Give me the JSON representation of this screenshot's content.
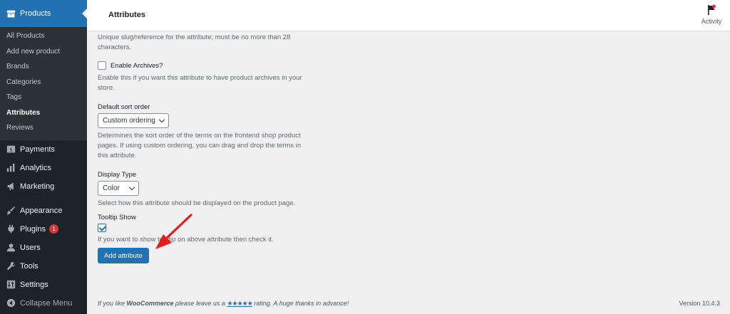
{
  "sidebar": {
    "products_label": "Products",
    "submenu": [
      "All Products",
      "Add new product",
      "Brands",
      "Categories",
      "Tags",
      "Attributes",
      "Reviews"
    ],
    "current_submenu": "Attributes",
    "payments": "Payments",
    "analytics": "Analytics",
    "marketing": "Marketing",
    "appearance": "Appearance",
    "plugins": "Plugins",
    "plugins_badge": "1",
    "users": "Users",
    "tools": "Tools",
    "settings": "Settings",
    "collapse": "Collapse Menu"
  },
  "header": {
    "title": "Attributes",
    "activity_label": "Activity"
  },
  "form": {
    "slug_desc": "Unique slug/reference for the attribute; must be no more than 28 characters.",
    "enable_archives_label": "Enable Archives?",
    "enable_archives_checked": false,
    "enable_archives_desc": "Enable this if you want this attribute to have product archives in your store.",
    "sort_order_label": "Default sort order",
    "sort_order_value": "Custom ordering",
    "sort_order_desc": "Determines the sort order of the terms on the frontend shop product pages. If using custom ordering, you can drag and drop the terms in this attribute.",
    "display_type_label": "Display Type",
    "display_type_value": "Color",
    "display_type_desc": "Select how this attribute should be displayed on the product page.",
    "tooltip_label": "Tooltip Show",
    "tooltip_checked": true,
    "tooltip_desc": "If you want to show tooltip on above attribute then check it.",
    "submit_label": "Add attribute"
  },
  "footer": {
    "text_before": "If you like ",
    "brand": "WooCommerce",
    "text_middle": " please leave us a ",
    "stars": "★★★★★",
    "text_after": " rating. A huge thanks in advance!",
    "version": "Version 10.4.3"
  },
  "colors": {
    "accent": "#2271b1",
    "sidebar_bg": "#1d2327",
    "annotation_arrow": "#e21d1d"
  }
}
